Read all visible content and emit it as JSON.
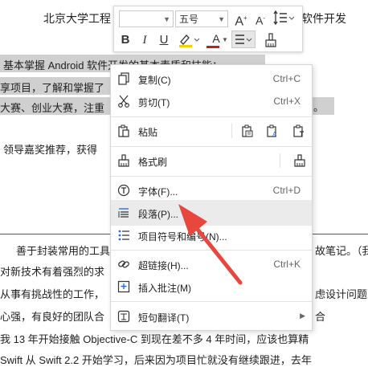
{
  "document": {
    "title_left": "北京大学工程",
    "title_right": "软件开发",
    "lines": [
      "基本掌握 Android 软件开发的基本素质和技能；",
      "享项目，了解和掌握了",
      "大赛、创业大赛，注重",
      "领导嘉奖推荐，获得",
      "善于封装常用的工具",
      "对新技术有着强烈的求",
      "从事有挑战性的工作，",
      "心强，有良好的团队合",
      "我 13 年开始接触 Objective-C  到现在差不多 4 年时间，应该也算精",
      "Swift 从 Swift 2.2 开始学习，后来因为项目忙就没有继续跟进，去年"
    ],
    "right_fragments": {
      "period": "。",
      "notes": "故笔记。（我",
      "design": "虑设计问题",
      "plus": "合"
    }
  },
  "mini_toolbar": {
    "font_name": "",
    "font_size": "五号",
    "grow_font": "A",
    "shrink_font": "A",
    "bold": "B",
    "italic": "I",
    "underline": "U",
    "font_color": "A"
  },
  "context_menu": {
    "items": [
      {
        "label": "复制(C)",
        "shortcut": "Ctrl+C",
        "icon": "copy-icon"
      },
      {
        "label": "剪切(T)",
        "shortcut": "Ctrl+X",
        "icon": "scissors-icon"
      },
      {
        "label": "粘贴",
        "shortcut": "",
        "icon": "paste-icon"
      },
      {
        "label": "格式刷",
        "shortcut": "",
        "icon": "format-brush-icon"
      },
      {
        "label": "字体(F)...",
        "shortcut": "Ctrl+D",
        "icon": "font-icon"
      },
      {
        "label": "段落(P)...",
        "shortcut": "",
        "icon": "paragraph-icon"
      },
      {
        "label": "项目符号和编号(N)...",
        "shortcut": "",
        "icon": "bullet-list-icon"
      },
      {
        "label": "超链接(H)...",
        "shortcut": "Ctrl+K",
        "icon": "link-icon"
      },
      {
        "label": "插入批注(M)",
        "shortcut": "",
        "icon": "comment-icon"
      },
      {
        "label": "短句翻译(T)",
        "shortcut": "",
        "icon": "translate-icon"
      }
    ],
    "highlighted_index": 5
  },
  "colors": {
    "arrow": "#e8473d",
    "selection": "#d0d0d0",
    "highlight_color_bar": "#f2d200",
    "font_color_bar": "#d01818",
    "menu_highlight": "#ebebeb"
  }
}
